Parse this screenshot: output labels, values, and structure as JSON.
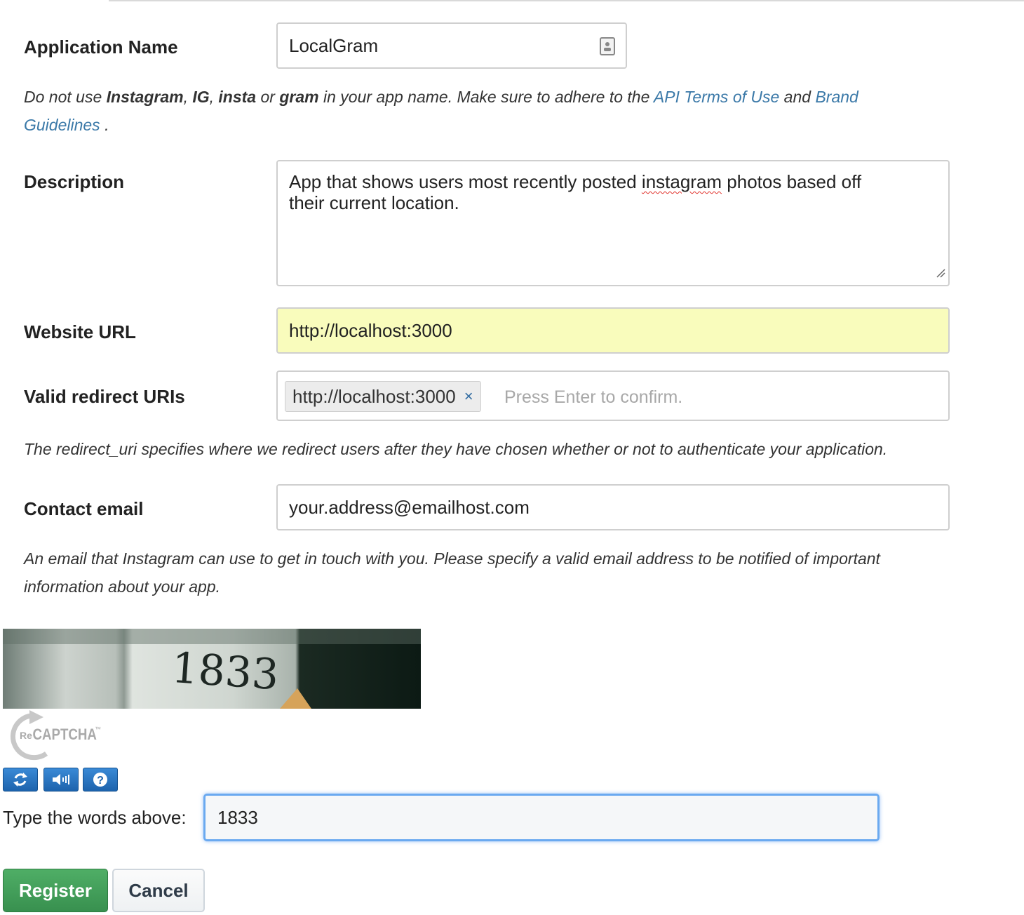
{
  "form": {
    "app_name_label": "Application Name",
    "app_name_value": "LocalGram",
    "name_help": {
      "p1": "Do not use ",
      "b1": "Instagram",
      "p2": ", ",
      "b2": "IG",
      "p3": ", ",
      "b3": "insta",
      "p4": " or ",
      "b4": "gram",
      "p5": " in your app name. Make sure to adhere to the ",
      "link1": "API Terms of Use",
      "p6": " and ",
      "link2_a": "Brand",
      "link2_b": "Guidelines",
      "p7": " ."
    },
    "description_label": "Description",
    "description": {
      "pre": "App that shows users most recently posted ",
      "misspelled": "instagram",
      "post": " photos based off",
      "line2": "their current location."
    },
    "website_label": "Website URL",
    "website_value": "http://localhost:3000",
    "redirect_label": "Valid redirect URIs",
    "redirect_tag": "http://localhost:3000",
    "redirect_tag_remove": "×",
    "redirect_placeholder": "Press Enter to confirm.",
    "redirect_help": "The redirect_uri specifies where we redirect users after they have chosen whether or not to authenticate your application.",
    "email_label": "Contact email",
    "email_value": "your.address@emailhost.com",
    "email_help_1": "An email that Instagram can use to get in touch with you. Please specify a valid email address to be notified of important",
    "email_help_2": "information about your app."
  },
  "captcha": {
    "image_text": "1833",
    "logo_re": "Re",
    "logo_captcha": "CAPTCHA",
    "logo_tm": "™",
    "type_label": "Type the words above:",
    "response_value": "1833",
    "buttons": [
      "refresh-icon",
      "audio-icon",
      "help-icon"
    ]
  },
  "actions": {
    "register": "Register",
    "cancel": "Cancel"
  },
  "colors": {
    "link": "#3b79a8",
    "autofill_bg": "#f9fcbc",
    "register_bg": "#3f9a57",
    "captcha_btn": "#1d63ad"
  }
}
